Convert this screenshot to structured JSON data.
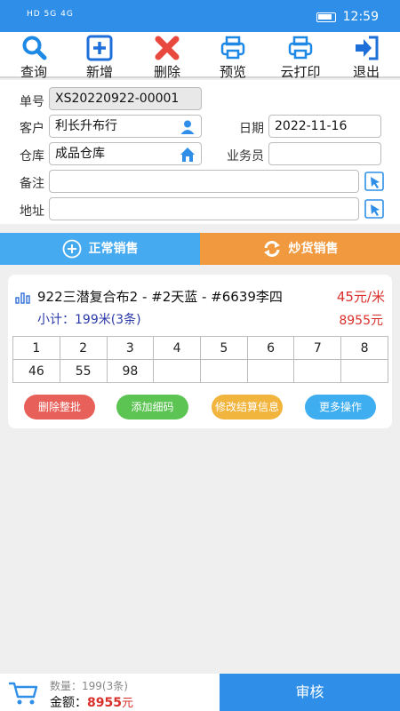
{
  "status": {
    "signal": "HD 5G 4G",
    "time": "12:59"
  },
  "toolbar": {
    "query": "查询",
    "add": "新增",
    "delete": "删除",
    "preview": "预览",
    "cloud_print": "云打印",
    "exit": "退出"
  },
  "form": {
    "order_no_label": "单号",
    "order_no": "XS20220922-00001",
    "customer_label": "客户",
    "customer": "利长升布行",
    "date_label": "日期",
    "date": "2022-11-16",
    "warehouse_label": "仓库",
    "warehouse": "成品仓库",
    "salesperson_label": "业务员",
    "salesperson": "",
    "remark_label": "备注",
    "remark": "",
    "address_label": "地址",
    "address": ""
  },
  "tabs": {
    "normal": "正常销售",
    "speculative": "炒货销售"
  },
  "item": {
    "name": "922三潜复合布2 - #2天蓝 - #6639李四",
    "price": "45元/米",
    "subtotal": "小计：199米(3条)",
    "amount": "8955元",
    "columns": [
      "1",
      "2",
      "3",
      "4",
      "5",
      "6",
      "7",
      "8"
    ],
    "values": [
      "46",
      "55",
      "98",
      "",
      "",
      "",
      "",
      ""
    ]
  },
  "actions": {
    "delete_batch": "删除整批",
    "add_detail": "添加细码",
    "edit_settlement": "修改结算信息",
    "more": "更多操作"
  },
  "footer": {
    "quantity": "数量：199(3条)",
    "total_label": "金额：",
    "total_value": "8955",
    "total_unit": "元",
    "approve": "审核"
  },
  "colors": {
    "primary": "#2f8fe8",
    "accent_orange": "#f0993e",
    "price_red": "#d9302c"
  }
}
